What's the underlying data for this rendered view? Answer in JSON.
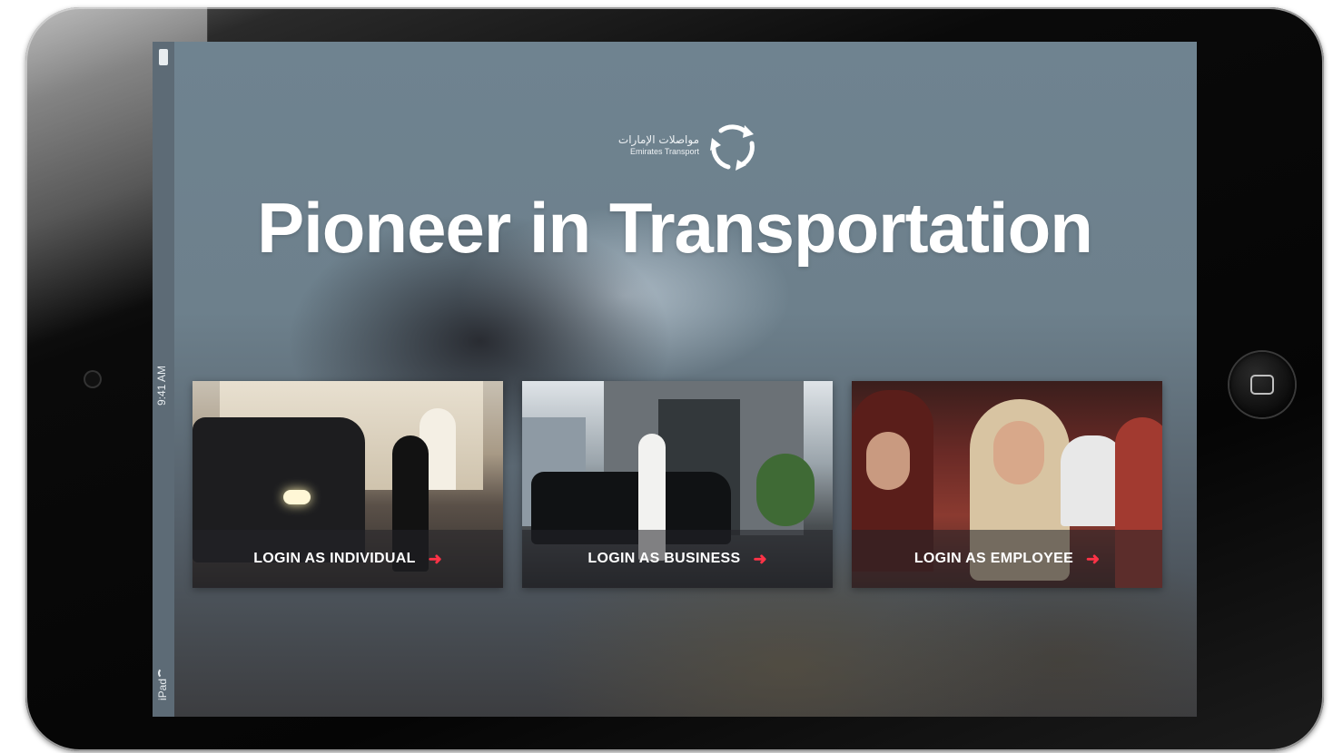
{
  "device": {
    "name": "iPad",
    "status_time": "9:41 AM",
    "carrier": "iPad"
  },
  "logo": {
    "arabic": "مواصلات الإمارات",
    "english": "Emirates Transport",
    "icon": "recycle-arrows-icon"
  },
  "headline": "Pioneer in Transportation",
  "cards": [
    {
      "label": "LOGIN AS INDIVIDUAL",
      "icon": "arrow-right-icon"
    },
    {
      "label": "LOGIN AS BUSINESS",
      "icon": "arrow-right-icon"
    },
    {
      "label": "LOGIN AS EMPLOYEE",
      "icon": "arrow-right-icon"
    }
  ],
  "colors": {
    "accent_arrow": "#ff3347",
    "headline": "#ffffff"
  }
}
